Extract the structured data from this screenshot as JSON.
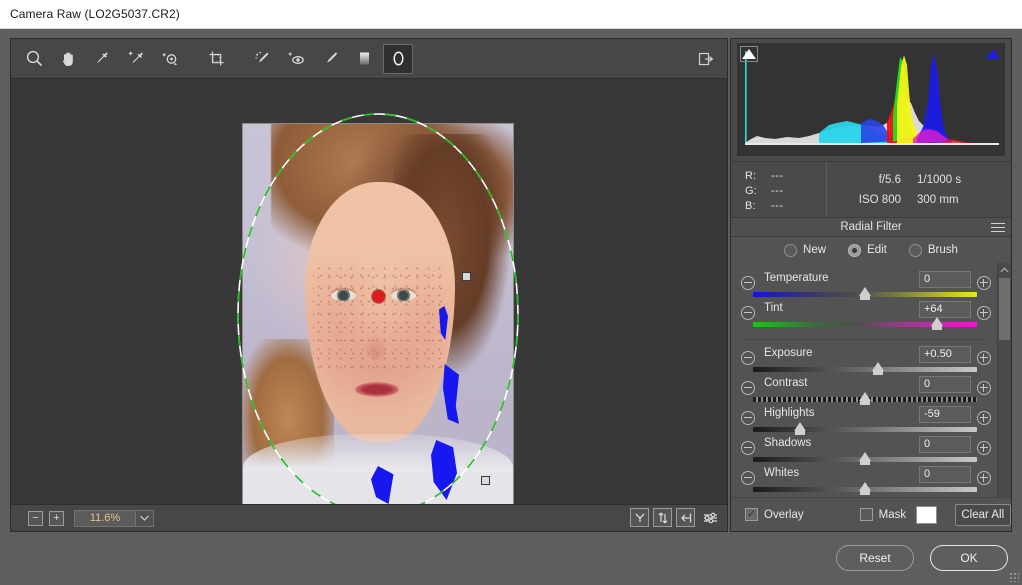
{
  "window": {
    "title": "Camera Raw (LO2G5037.CR2)"
  },
  "toolbar": {
    "tools": [
      {
        "name": "zoom-tool",
        "label": "Zoom Tool",
        "selected": false
      },
      {
        "name": "hand-tool",
        "label": "Hand Tool",
        "selected": false
      },
      {
        "name": "white-balance-tool",
        "label": "White Balance Tool",
        "selected": false
      },
      {
        "name": "color-sampler-tool",
        "label": "Color Sampler Tool",
        "selected": false
      },
      {
        "name": "targeted-adjustment-tool",
        "label": "Targeted Adjustment Tool",
        "selected": false
      },
      {
        "name": "crop-tool",
        "label": "Crop Tool",
        "selected": false
      },
      {
        "name": "spot-removal-tool",
        "label": "Spot Removal",
        "selected": false
      },
      {
        "name": "red-eye-removal-tool",
        "label": "Red Eye Removal",
        "selected": false
      },
      {
        "name": "adjustment-brush-tool",
        "label": "Adjustment Brush",
        "selected": false
      },
      {
        "name": "graduated-filter-tool",
        "label": "Graduated Filter",
        "selected": false
      },
      {
        "name": "radial-filter-tool",
        "label": "Radial Filter",
        "selected": true
      }
    ],
    "preferences_label": "Preferences"
  },
  "image_view": {
    "zoom_level": "11.6%",
    "zoom_out_label": "−",
    "zoom_in_label": "+",
    "overlay_pin_color": "#e01b1b",
    "ellipse_stroke_colors": [
      "#ffffff",
      "#1fc11f"
    ],
    "clipping_color": "#1717f0",
    "view_icons": [
      {
        "name": "preview-mode-icon",
        "glyph": "Y"
      },
      {
        "name": "before-after-swap-icon",
        "glyph": "⇅"
      },
      {
        "name": "copy-current-settings-icon",
        "glyph": "⬅"
      },
      {
        "name": "preview-preferences-icon",
        "glyph": "≡"
      }
    ]
  },
  "histogram": {
    "shadow_clipping_label": "Shadow clipping warning",
    "highlight_clipping_label": "Highlight clipping warning",
    "shadow_clipping_on": true,
    "highlight_clipping_on": true,
    "highlight_indicator_color": "#1c1ce0"
  },
  "readout": {
    "channels": [
      {
        "label": "R:",
        "value": "---"
      },
      {
        "label": "G:",
        "value": "---"
      },
      {
        "label": "B:",
        "value": "---"
      }
    ],
    "shot_info": [
      {
        "left": "f/5.6",
        "right": "1/1000 s"
      },
      {
        "left": "ISO 800",
        "right": "300 mm"
      }
    ]
  },
  "panel": {
    "title": "Radial Filter",
    "menu_label": "Panel Menu",
    "modes": [
      {
        "label": "New",
        "selected": false
      },
      {
        "label": "Edit",
        "selected": true
      },
      {
        "label": "Brush",
        "selected": false
      }
    ],
    "sliders": [
      {
        "name": "temperature",
        "label": "Temperature",
        "value": "0",
        "pos": 50,
        "track": "temp"
      },
      {
        "name": "tint",
        "label": "Tint",
        "value": "+64",
        "pos": 82,
        "track": "tint"
      },
      {
        "name": "exposure",
        "label": "Exposure",
        "value": "+0.50",
        "pos": 56,
        "track": "plain"
      },
      {
        "name": "contrast",
        "label": "Contrast",
        "value": "0",
        "pos": 50,
        "track": "contrast"
      },
      {
        "name": "highlights",
        "label": "Highlights",
        "value": "-59",
        "pos": 21,
        "track": "plain"
      },
      {
        "name": "shadows",
        "label": "Shadows",
        "value": "0",
        "pos": 50,
        "track": "plain"
      },
      {
        "name": "whites",
        "label": "Whites",
        "value": "0",
        "pos": 50,
        "track": "plain"
      }
    ],
    "footer": {
      "overlay_label": "Overlay",
      "overlay_checked": true,
      "mask_label": "Mask",
      "mask_checked": false,
      "mask_color": "#ffffff",
      "clear_all_label": "Clear All"
    },
    "scroll_up_glyph": "⌃",
    "scroll_down_glyph": "⌄"
  },
  "dialog_buttons": {
    "reset_label": "Reset",
    "ok_label": "OK"
  }
}
